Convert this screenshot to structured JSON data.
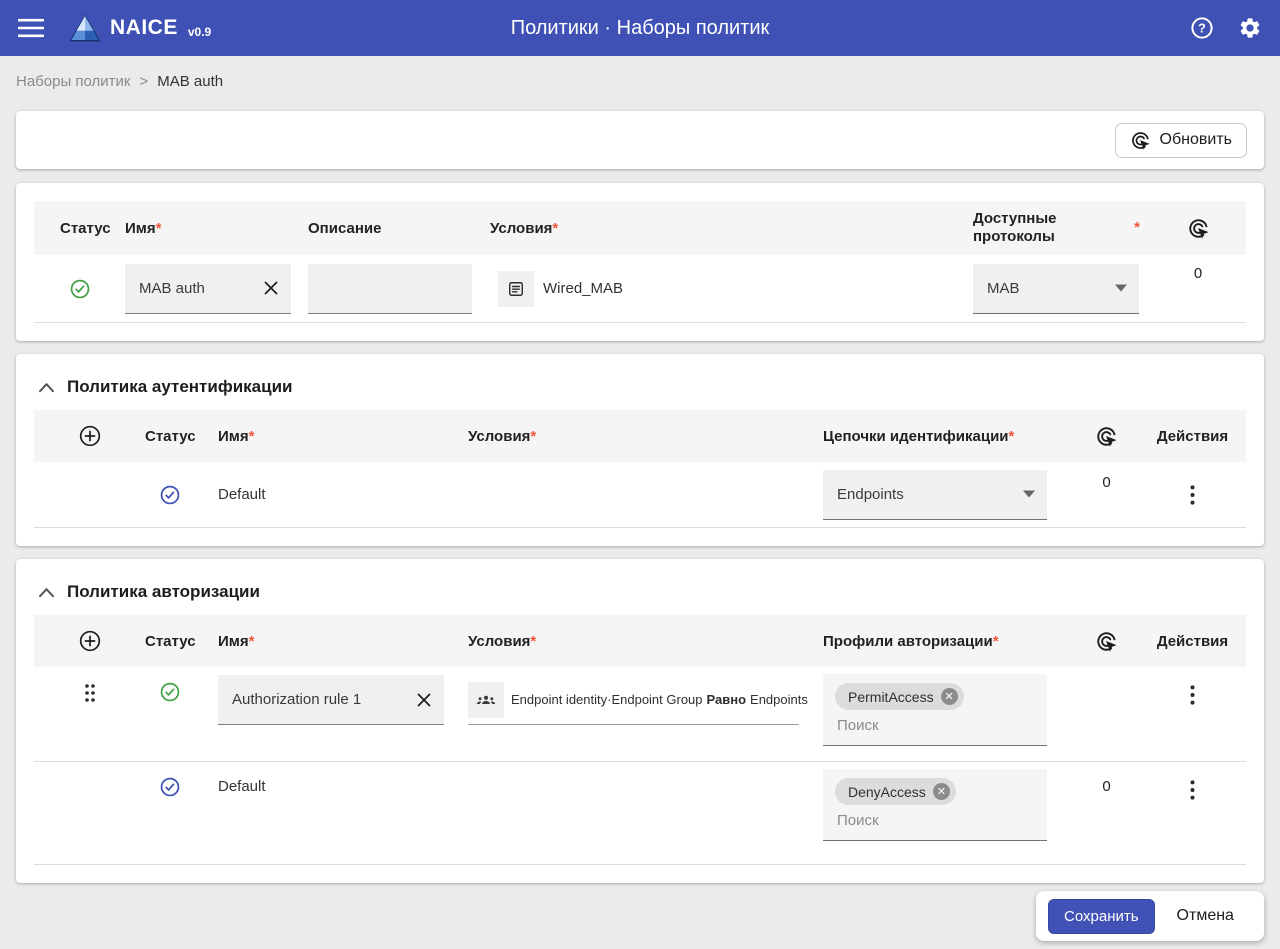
{
  "app_bar": {
    "brand": "NAICE",
    "version": "v0.9",
    "title": "Политики · Наборы политик"
  },
  "breadcrumb": {
    "parent": "Наборы политик",
    "separator": ">",
    "current": "MAB auth"
  },
  "toolbar": {
    "refresh_label": "Обновить"
  },
  "required_mark": "*",
  "policy_set": {
    "headers": {
      "status": "Статус",
      "name": "Имя",
      "description": "Описание",
      "conditions": "Условия",
      "protocols": "Доступные протоколы"
    },
    "row": {
      "name_value": "MAB auth",
      "description_value": "",
      "condition_value": "Wired_MAB",
      "protocol_value": "MAB",
      "hits": "0"
    }
  },
  "authentication": {
    "title": "Политика аутентификации",
    "headers": {
      "status": "Статус",
      "name": "Имя",
      "conditions": "Условия",
      "identity_chains": "Цепочки идентификации",
      "actions": "Действия"
    },
    "row": {
      "name": "Default",
      "identity_chain_value": "Endpoints",
      "hits": "0"
    }
  },
  "authorization": {
    "title": "Политика авторизации",
    "headers": {
      "status": "Статус",
      "name": "Имя",
      "conditions": "Условия",
      "profiles": "Профили авторизации",
      "actions": "Действия"
    },
    "rows": [
      {
        "name_value": "Authorization rule 1",
        "condition_left": "Endpoint identity·Endpoint Group",
        "condition_operator": "Равно",
        "condition_right": "Endpoints",
        "profile_chip": "PermitAccess",
        "search_placeholder": "Поиск"
      },
      {
        "name": "Default",
        "profile_chip": "DenyAccess",
        "search_placeholder": "Поиск",
        "hits": "0"
      }
    ]
  },
  "footer": {
    "save": "Сохранить",
    "cancel": "Отмена"
  },
  "colors": {
    "app_bar": "#4051b5",
    "accent": "#4052b5",
    "status_green": "#43a047",
    "status_blue": "#3f51b5",
    "required": "#f4543c",
    "chip_bg": "#dcdcdc"
  }
}
